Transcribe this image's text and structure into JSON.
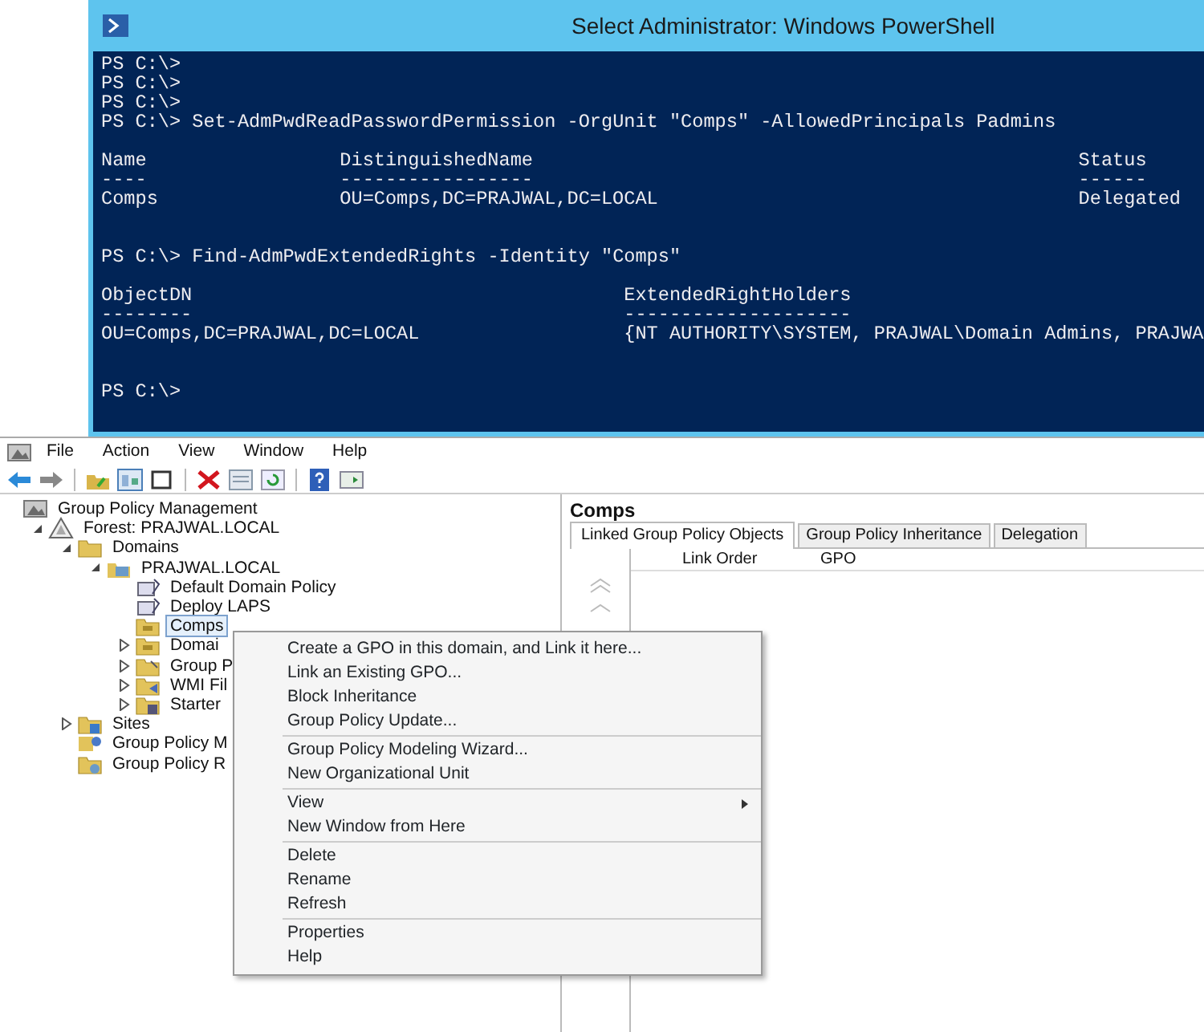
{
  "powershell": {
    "title": "Select Administrator: Windows PowerShell",
    "blocks": [
      {
        "kind": "prompt",
        "lines": [
          "PS C:\\>",
          "PS C:\\>",
          "PS C:\\>",
          "PS C:\\> Set-AdmPwdReadPasswordPermission -OrgUnit \"Comps\" -AllowedPrincipals Padmins"
        ]
      },
      {
        "kind": "table",
        "header": [
          "Name",
          "DistinguishedName",
          "Status"
        ],
        "rule": [
          "----",
          "-----------------",
          "------"
        ],
        "rows": [
          [
            "Comps",
            "OU=Comps,DC=PRAJWAL,DC=LOCAL",
            "Delegated"
          ]
        ]
      },
      {
        "kind": "prompt",
        "lines": [
          "PS C:\\> Find-AdmPwdExtendedRights -Identity \"Comps\""
        ]
      },
      {
        "kind": "table",
        "header": [
          "ObjectDN",
          "ExtendedRightHolders"
        ],
        "rule": [
          "--------",
          "--------------------"
        ],
        "rows": [
          [
            "OU=Comps,DC=PRAJWAL,DC=LOCAL",
            "{NT AUTHORITY\\SYSTEM, PRAJWAL\\Domain Admins, PRAJWA"
          ]
        ]
      },
      {
        "kind": "prompt",
        "lines": [
          "PS C:\\>"
        ]
      }
    ]
  },
  "gpmc": {
    "menu": [
      "File",
      "Action",
      "View",
      "Window",
      "Help"
    ],
    "tree": [
      {
        "label": "Group Policy Management",
        "kind": "root",
        "children": [
          {
            "label": "Forest: PRAJWAL.LOCAL",
            "kind": "forest",
            "expanded": true,
            "children": [
              {
                "label": "Domains",
                "kind": "folder",
                "expanded": true,
                "children": [
                  {
                    "label": "PRAJWAL.LOCAL",
                    "kind": "domain",
                    "expanded": true,
                    "children": [
                      {
                        "label": "Default Domain Policy",
                        "kind": "gpo",
                        "selected": false
                      },
                      {
                        "label": "Deploy LAPS",
                        "kind": "gpo",
                        "selected": false
                      },
                      {
                        "label": "Comps",
                        "kind": "ou",
                        "selected": true
                      },
                      {
                        "label": "Domai",
                        "kind": "ou",
                        "expanded": false,
                        "selected": false
                      },
                      {
                        "label": "Group P",
                        "kind": "gpo-folder",
                        "expanded": false,
                        "selected": false
                      },
                      {
                        "label": "WMI Fil",
                        "kind": "wmi",
                        "expanded": false,
                        "selected": false
                      },
                      {
                        "label": "Starter",
                        "kind": "starter",
                        "expanded": false,
                        "selected": false
                      }
                    ]
                  }
                ]
              },
              {
                "label": "Sites",
                "kind": "sites",
                "expanded": false
              },
              {
                "label": "Group Policy M",
                "kind": "modeling"
              },
              {
                "label": "Group Policy R",
                "kind": "results"
              }
            ]
          }
        ]
      }
    ],
    "panel": {
      "title": "Comps",
      "tabs": [
        {
          "label": "Linked Group Policy Objects",
          "selected": true
        },
        {
          "label": "Group Policy Inheritance",
          "selected": false
        },
        {
          "label": "Delegation",
          "selected": false
        }
      ],
      "columns": [
        "Link Order",
        "GPO"
      ]
    }
  },
  "context_menu": {
    "groups": [
      [
        {
          "label": "Create a GPO in this domain, and Link it here..."
        },
        {
          "label": "Link an Existing GPO..."
        },
        {
          "label": "Block Inheritance"
        },
        {
          "label": "Group Policy Update..."
        }
      ],
      [
        {
          "label": "Group Policy Modeling Wizard..."
        },
        {
          "label": "New Organizational Unit"
        }
      ],
      [
        {
          "label": "View",
          "submenu": true
        },
        {
          "label": "New Window from Here"
        }
      ],
      [
        {
          "label": "Delete"
        },
        {
          "label": "Rename"
        },
        {
          "label": "Refresh"
        }
      ],
      [
        {
          "label": "Properties"
        },
        {
          "label": "Help"
        }
      ]
    ]
  }
}
